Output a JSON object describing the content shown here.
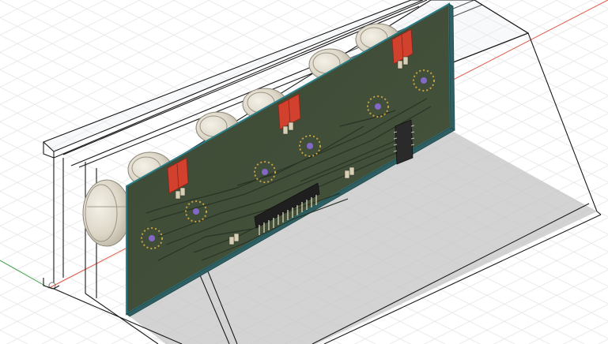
{
  "viewport": {
    "mode": "3d-model",
    "background": "#ffffff",
    "grid_visible": true
  },
  "colors": {
    "grid_minor": "#e6e6e6",
    "grid_major": "#cfcfcf",
    "axis_x": "#e05a4a",
    "axis_y": "#3aa045",
    "enclosure_edge": "#1a1a1a",
    "enclosure_fill": "#d8dde2",
    "shadow": "#bdbdbd",
    "pcb": "#3d4a36",
    "pcb_edge": "#2b7f8a",
    "trace": "#2a3326",
    "pad": "#c8a040",
    "tube_glass": "#e4dfd2",
    "tube_ring": "#9b9585",
    "connector_red": "#d2402e",
    "component_dark": "#2a2a2a",
    "mount_hole": "#8468c8"
  },
  "icons": [
    "x-axis-line",
    "y-axis-line",
    "origin-marker"
  ]
}
